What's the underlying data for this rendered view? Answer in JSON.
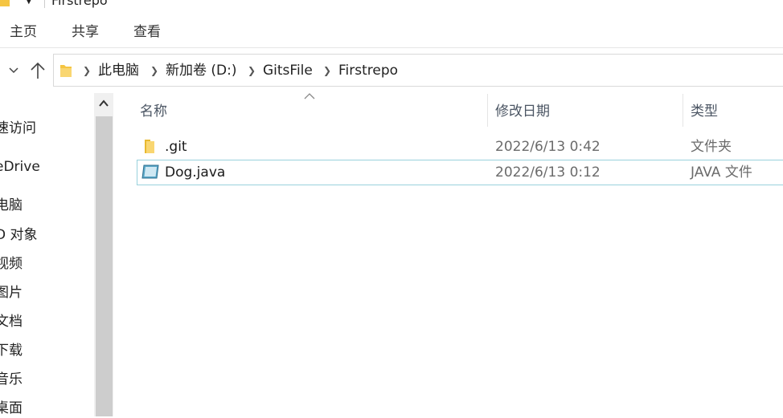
{
  "window": {
    "title": "Firstrepo"
  },
  "ribbon": {
    "tabs": [
      "主页",
      "共享",
      "查看"
    ]
  },
  "address": {
    "segments": [
      "此电脑",
      "新加卷 (D:)",
      "GitsFile",
      "Firstrepo"
    ]
  },
  "nav_pane": {
    "items": [
      "速访问",
      "eDrive",
      "电脑",
      "D 对象",
      "视频",
      "图片",
      "文档",
      "下载",
      "音乐",
      "桌面"
    ]
  },
  "columns": {
    "name": "名称",
    "date": "修改日期",
    "type": "类型"
  },
  "files": [
    {
      "name": ".git",
      "date": "2022/6/13 0:42",
      "type": "文件夹",
      "icon": "folder-icon"
    },
    {
      "name": "Dog.java",
      "date": "2022/6/13 0:12",
      "type": "JAVA 文件",
      "icon": "java-file-icon",
      "selected": true
    }
  ],
  "colors": {
    "folder": "#f5c542",
    "selection_border": "#99d1dc"
  }
}
